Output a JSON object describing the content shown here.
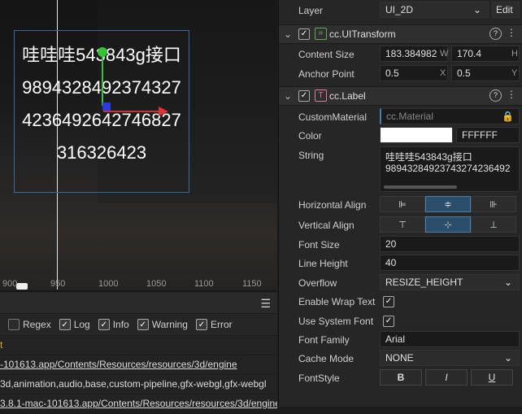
{
  "scene": {
    "label_lines": [
      "哇哇哇543843g接口",
      "9894328492374327",
      "4236492642746827",
      "316326423"
    ],
    "ruler": [
      "900",
      "950",
      "1000",
      "1050",
      "1100",
      "1150"
    ]
  },
  "console": {
    "filters": [
      {
        "label": "Regex",
        "checked": false
      },
      {
        "label": "Log",
        "checked": true
      },
      {
        "label": "Info",
        "checked": true
      },
      {
        "label": "Warning",
        "checked": true
      },
      {
        "label": "Error",
        "checked": true
      }
    ],
    "lines": [
      "t",
      "-101613.app/Contents/Resources/resources/3d/engine",
      "3d,animation,audio,base,custom-pipeline,gfx-webgl,gfx-webgl",
      "3.8.1-mac-101613.app/Contents/Resources/resources/3d/engine"
    ]
  },
  "inspector": {
    "layer_label": "Layer",
    "layer_value": "UI_2D",
    "edit_button": "Edit",
    "uitransform_title": "cc.UITransform",
    "content_size_label": "Content Size",
    "content_w": "183.384982",
    "content_h": "170.4",
    "axis_w": "W",
    "axis_h": "H",
    "anchor_label": "Anchor Point",
    "anchor_x": "0.5",
    "anchor_y": "0.5",
    "axis_x": "X",
    "axis_y": "Y",
    "label_title": "cc.Label",
    "custom_material_label": "CustomMaterial",
    "custom_material_value": "cc.Material",
    "color_label": "Color",
    "color_value": "FFFFFF",
    "string_label": "String",
    "string_line1": "哇哇哇543843g接口",
    "string_line2": "98943284923743274236492",
    "halign_label": "Horizontal Align",
    "valign_label": "Vertical Align",
    "font_size_label": "Font Size",
    "font_size_value": "20",
    "line_height_label": "Line Height",
    "line_height_value": "40",
    "overflow_label": "Overflow",
    "overflow_value": "RESIZE_HEIGHT",
    "wrap_label": "Enable Wrap Text",
    "system_font_label": "Use System Font",
    "font_family_label": "Font Family",
    "font_family_value": "Arial",
    "cache_mode_label": "Cache Mode",
    "cache_mode_value": "NONE",
    "font_style_label": "FontStyle",
    "bold": "B",
    "italic": "I",
    "underline": "U"
  },
  "colors": {
    "accent": "#2b4e6a",
    "label_color": "#FFFFFF",
    "gizmo_x": "#c03535",
    "gizmo_y": "#3ec03e"
  }
}
